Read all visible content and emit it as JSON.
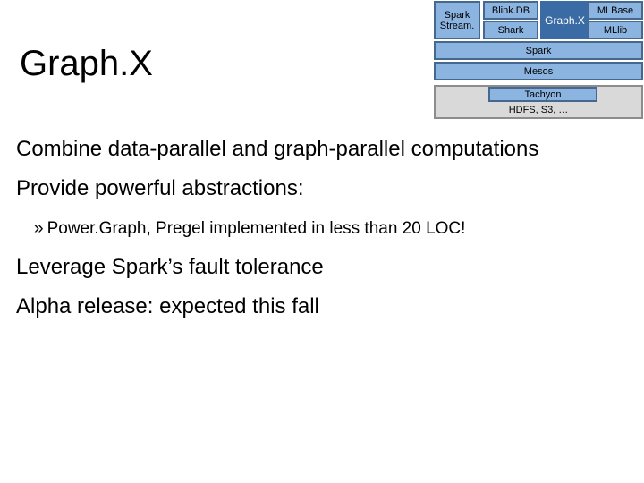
{
  "slide": {
    "title": "Graph.X",
    "background_color": "#ffffff"
  },
  "diagram": {
    "name": "berkeley-data-analytics-stack",
    "colors": {
      "box_fill": "#8cb4e0",
      "box_border": "#46688e",
      "highlight_fill": "#3a6ba5",
      "highlight_text": "#ffffff",
      "storage_fill": "#d9d9d9",
      "storage_border": "#8c8c8c"
    },
    "components": {
      "spark_streaming_line1": "Spark",
      "spark_streaming_line2": "Stream.",
      "blinkdb": "Blink.DB",
      "shark": "Shark",
      "graphx": "Graph.X",
      "mlbase": "MLBase",
      "mllib": "MLlib"
    },
    "tiers": {
      "spark": "Spark",
      "mesos": "Mesos",
      "tachyon": "Tachyon",
      "storage": "HDFS, S3, …"
    }
  },
  "body": {
    "bullets": [
      {
        "level": 1,
        "text": "Combine data-parallel and graph-parallel computations"
      },
      {
        "level": 1,
        "text": "Provide powerful abstractions:"
      },
      {
        "level": 2,
        "marker": "»",
        "text": "Power.Graph, Pregel implemented in less than 20 LOC!"
      },
      {
        "level": 1,
        "text": "Leverage Spark’s fault tolerance"
      },
      {
        "level": 1,
        "text": "Alpha release: expected this fall"
      }
    ]
  }
}
